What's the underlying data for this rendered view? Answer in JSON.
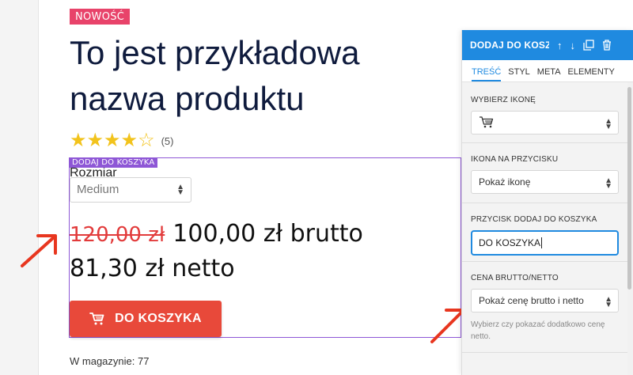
{
  "product": {
    "badge": "NOWOŚĆ",
    "title": "To jest przykładowa nazwa produktu",
    "rating_count": "(5)",
    "rating_value": 4,
    "rating_max": 5,
    "variant_label": "Rozmiar",
    "variant_selected": "Medium",
    "old_price": "120,00 zł",
    "gross_price": "100,00 zł brutto",
    "net_price": "81,30 zł netto",
    "cart_button_label": "DO KOSZYKA",
    "stock_text": "W magazynie: 77"
  },
  "editor": {
    "selection_tag": "DODAJ DO KOSZYKA"
  },
  "panel": {
    "title": "DODAJ DO KOSZYKA",
    "tabs": [
      "TREŚĆ",
      "STYL",
      "META",
      "ELEMENTY"
    ],
    "active_tab": 0,
    "icon_section_label": "WYBIERZ IKONĘ",
    "icon_on_button_label": "IKONA NA PRZYCISKU",
    "icon_on_button_value": "Pokaż ikonę",
    "button_text_label": "PRZYCISK DODAJ DO KOSZYKA",
    "button_text_value": "DO KOSZYKA",
    "price_mode_label": "CENA BRUTTO/NETTO",
    "price_mode_value": "Pokaż cenę brutto i netto",
    "price_mode_hint": "Wybierz czy pokazać dodatkowo cenę netto."
  },
  "colors": {
    "accent": "#1f8ae0",
    "badge": "#e8436a",
    "button": "#e8493a",
    "selection": "#8e57d6",
    "arrow": "#e8361f",
    "old_price": "#e23b3b"
  },
  "icons": [
    "cart-icon",
    "arrow-up-icon",
    "arrow-down-icon",
    "duplicate-icon",
    "trash-icon",
    "select-arrows-icon",
    "annotation-arrow"
  ]
}
